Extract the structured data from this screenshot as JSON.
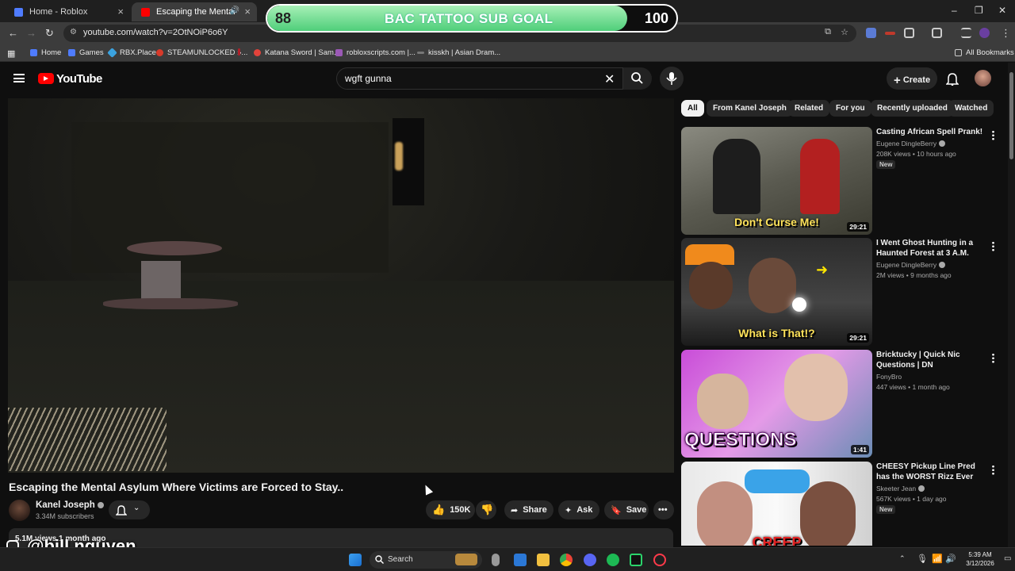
{
  "browser": {
    "tabs": [
      {
        "label": "Home - Roblox",
        "active": false
      },
      {
        "label": "Escaping the Mental Asylu",
        "active": true
      }
    ],
    "url": "youtube.com/watch?v=2OtNOiP6o6Y",
    "bookmarks": [
      "Home",
      "Games",
      "RBX.Place",
      "STEAMUNLOCKED »...",
      "Katana Sword | Sam...",
      "robloxscripts.com |...",
      "kisskh | Asian Dram..."
    ],
    "all_bookmarks": "All Bookmarks",
    "window_controls": [
      "–",
      "❐",
      "✕"
    ]
  },
  "sub_goal": {
    "start": "88",
    "title": "BAC TATTOO SUB GOAL",
    "end": "100",
    "progress_fraction": 0.88
  },
  "youtube": {
    "logo_text": "YouTube",
    "search_query": "wgft gunna",
    "create_label": "Create"
  },
  "video": {
    "title": "Escaping the Mental Asylum Where Victims are Forced to Stay..",
    "channel": "Kanel Joseph",
    "subscribers": "3.34M subscribers",
    "likes": "150K",
    "share_label": "Share",
    "ask_label": "Ask",
    "save_label": "Save",
    "desc_line": "5.1M views  1 month ago"
  },
  "watermark": "@bill.nguyen",
  "chips": [
    "All",
    "From Kanel Joseph",
    "Related",
    "For you",
    "Recently uploaded",
    "Watched"
  ],
  "recommendations": [
    {
      "title": "Casting African Spell Prank!",
      "channel": "Eugene DingleBerry",
      "meta": "208K views • 10 hours ago",
      "badge": "New",
      "duration": "29:21",
      "thumb_text": "Don't Curse Me!"
    },
    {
      "title": "I Went Ghost Hunting in a Haunted Forest at 3 A.M.",
      "channel": "Eugene DingleBerry",
      "meta": "2M views • 9 months ago",
      "badge": "",
      "duration": "29:21",
      "thumb_text": "What is That!?"
    },
    {
      "title": "Bricktucky | Quick Nic Questions | DN",
      "channel": "FonyBro",
      "meta": "447 views • 1 month ago",
      "badge": "",
      "duration": "1:41",
      "thumb_text": "QUESTIONS"
    },
    {
      "title": "CHEESY Pickup Line Pred has the WORST Rizz Ever",
      "channel": "Skeeter Jean",
      "meta": "567K views • 1 day ago",
      "badge": "New",
      "duration": "",
      "thumb_text": "CREEP"
    }
  ],
  "taskbar": {
    "search_placeholder": "Search",
    "time": "5:39 AM",
    "date": "3/12/2026"
  },
  "colors": {
    "youtube_red": "#ff0000",
    "goal_fill": "#4fce7a",
    "background": "#0f0f0f"
  }
}
